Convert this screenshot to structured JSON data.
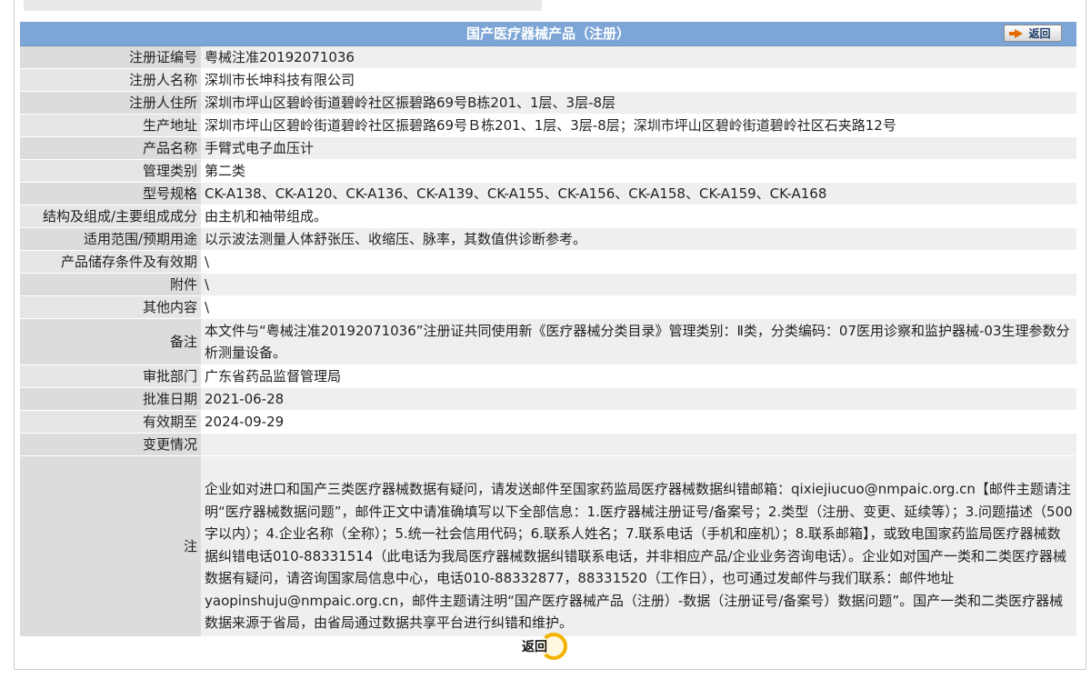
{
  "header": {
    "title": "国产医疗器械产品（注册）",
    "back_label": "返回"
  },
  "rows": [
    {
      "label": "注册证编号",
      "value": "粤械注准20192071036"
    },
    {
      "label": "注册人名称",
      "value": "深圳市长坤科技有限公司"
    },
    {
      "label": "注册人住所",
      "value": "深圳市坪山区碧岭街道碧岭社区振碧路69号B栋201、1层、3层-8层"
    },
    {
      "label": "生产地址",
      "value": "深圳市坪山区碧岭街道碧岭社区振碧路69号Ｂ栋201、1层、3层-8层；深圳市坪山区碧岭街道碧岭社区石夹路12号"
    },
    {
      "label": "产品名称",
      "value": "手臂式电子血压计"
    },
    {
      "label": "管理类别",
      "value": "第二类"
    },
    {
      "label": "型号规格",
      "value": "CK-A138、CK-A120、CK-A136、CK-A139、CK-A155、CK-A156、CK-A158、CK-A159、CK-A168"
    },
    {
      "label": "结构及组成/主要组成成分",
      "value": "由主机和袖带组成。"
    },
    {
      "label": "适用范围/预期用途",
      "value": "以示波法测量人体舒张压、收缩压、脉率，其数值供诊断参考。"
    },
    {
      "label": "产品储存条件及有效期",
      "value": "\\"
    },
    {
      "label": "附件",
      "value": "\\"
    },
    {
      "label": "其他内容",
      "value": "\\"
    },
    {
      "label": "备注",
      "value": "本文件与“粤械注准20192071036”注册证共同使用新《医疗器械分类目录》管理类别：Ⅱ类，分类编码：07医用诊察和监护器械-03生理参数分析测量设备。"
    },
    {
      "label": "审批部门",
      "value": "广东省药品监督管理局"
    },
    {
      "label": "批准日期",
      "value": "2021-06-28"
    },
    {
      "label": "有效期至",
      "value": "2024-09-29"
    },
    {
      "label": "变更情况",
      "value": ""
    },
    {
      "label": "注",
      "value": "企业如对进口和国产三类医疗器械数据有疑问，请发送邮件至国家药监局医疗器械数据纠错邮箱：qixiejiucuo@nmpaic.org.cn【邮件主题请注明“医疗器械数据问题”，邮件正文中请准确填写以下全部信息：1.医疗器械注册证号/备案号；2.类型（注册、变更、延续等）；3.问题描述（500字以内）；4.企业名称（全称）；5.统一社会信用代码；6.联系人姓名；7.联系电话（手机和座机）；8.联系邮箱】，或致电国家药监局医疗器械数据纠错电话010-88331514（此电话为我局医疗器械数据纠错联系电话，并非相应产品/企业业务咨询电话）。企业如对国产一类和二类医疗器械数据有疑问，请咨询国家局信息中心，电话010-88332877，88331520（工作日），也可通过发邮件与我们联系：邮件地址yaopinshuju@nmpaic.org.cn，邮件主题请注明“国产医疗器械产品（注册）-数据（注册证号/备案号）数据问题”。国产一类和二类医疗器械数据来源于省局，由省局通过数据共享平台进行纠错和维护。"
    }
  ],
  "footer": {
    "back_label": "返回"
  }
}
